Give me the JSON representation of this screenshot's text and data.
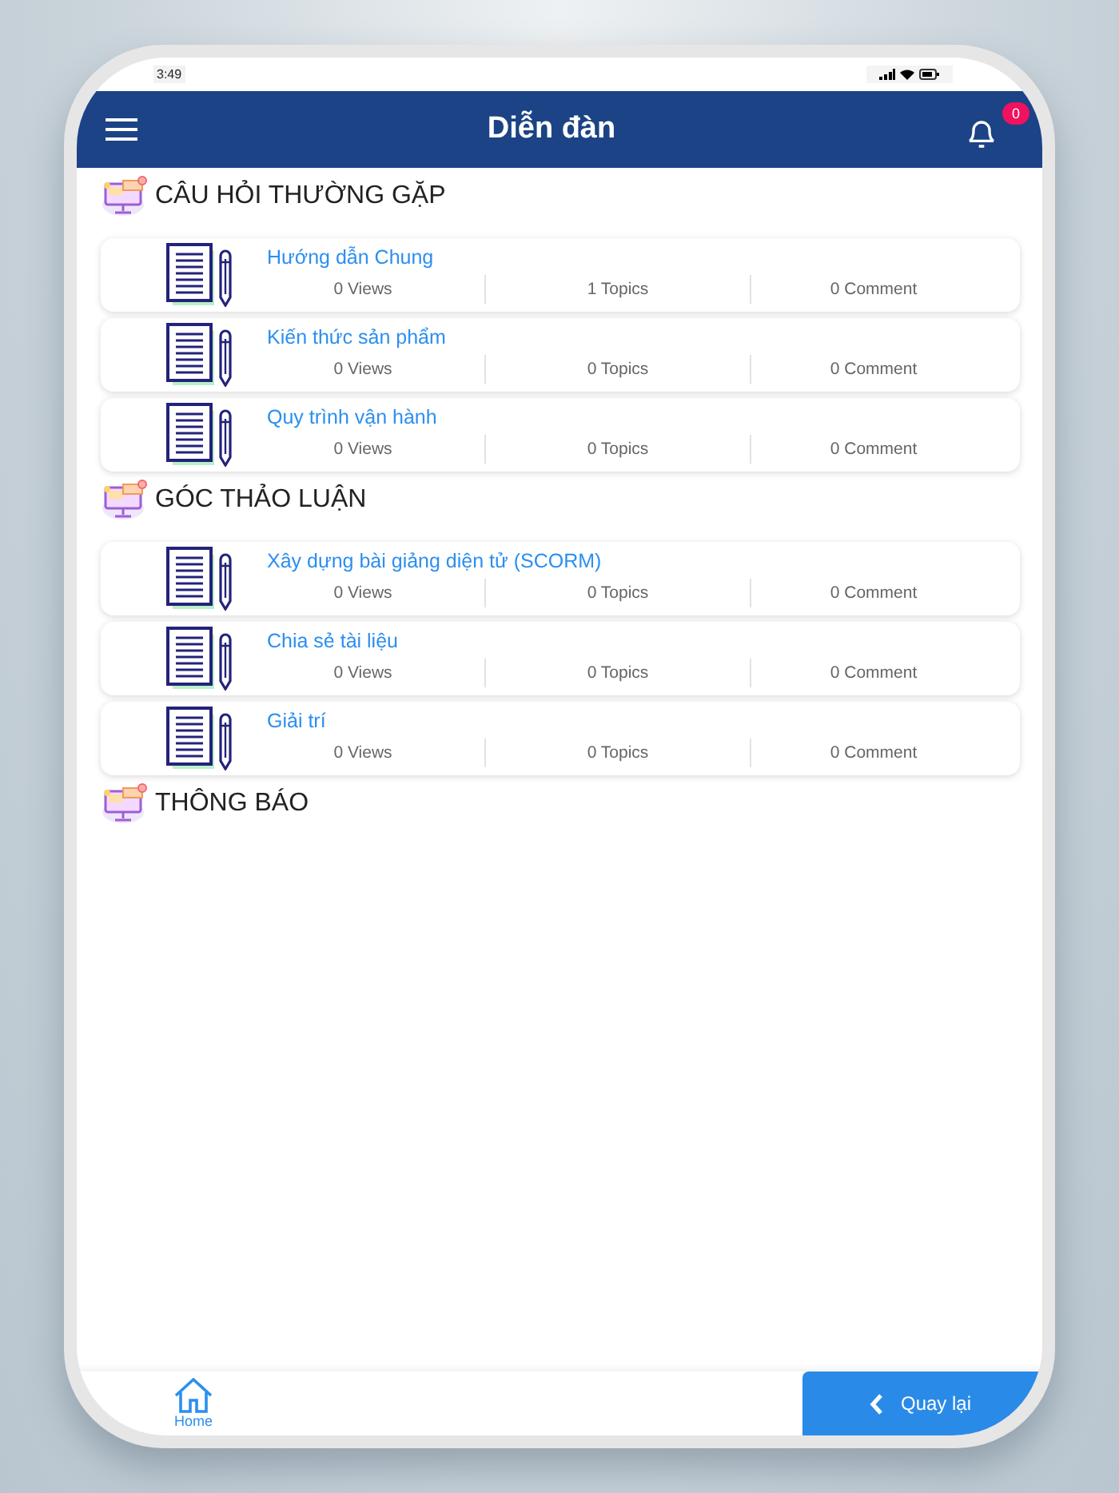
{
  "status_bar": {
    "time": "3:49"
  },
  "header": {
    "title": "Diễn đàn",
    "notification_count": "0"
  },
  "sections": [
    {
      "title": "CÂU HỎI THƯỜNG GẶP",
      "topics": [
        {
          "title": "Hướng dẫn Chung",
          "views": "0 Views",
          "topics": "1 Topics",
          "comments": "0 Comment"
        },
        {
          "title": "Kiến thức sản phẩm",
          "views": "0 Views",
          "topics": "0 Topics",
          "comments": "0 Comment"
        },
        {
          "title": "Quy trình vận hành",
          "views": "0 Views",
          "topics": "0 Topics",
          "comments": "0 Comment"
        }
      ]
    },
    {
      "title": "GÓC THẢO LUẬN",
      "topics": [
        {
          "title": "Xây dựng bài giảng diện tử (SCORM)",
          "views": "0 Views",
          "topics": "0 Topics",
          "comments": "0 Comment"
        },
        {
          "title": "Chia sẻ tài liệu",
          "views": "0 Views",
          "topics": "0 Topics",
          "comments": "0 Comment"
        },
        {
          "title": "Giải trí",
          "views": "0 Views",
          "topics": "0 Topics",
          "comments": "0 Comment"
        }
      ]
    },
    {
      "title": "THÔNG BÁO"
    }
  ],
  "bottom_bar": {
    "home_label": "Home",
    "back_button": "Quay lại"
  }
}
